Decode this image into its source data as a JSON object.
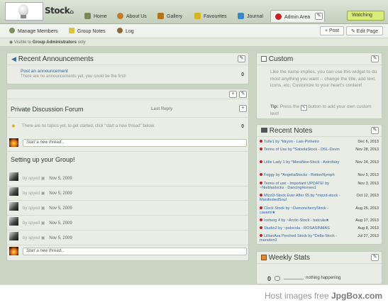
{
  "header": {
    "group_name": "Stock",
    "home_glyph": "⌂",
    "tabs": [
      {
        "label": "Home",
        "icon": "home-icon",
        "color": "#7a8a55"
      },
      {
        "label": "About Us",
        "icon": "people-icon",
        "color": "#c27a2c"
      },
      {
        "label": "Gallery",
        "icon": "gallery-icon",
        "color": "#b0741f"
      },
      {
        "label": "Favourites",
        "icon": "star-icon",
        "color": "#d6b41c"
      },
      {
        "label": "Journal",
        "icon": "journal-icon",
        "color": "#3b88c2"
      },
      {
        "label": "Admin Area",
        "icon": "no-entry-icon",
        "color": "#c82020"
      }
    ],
    "tab_edit_glyph": "✎",
    "watching_label": "Watching"
  },
  "subnav": {
    "items": [
      {
        "label": "Manage Members",
        "icon": "members-icon"
      },
      {
        "label": "Group Notes",
        "icon": "notes-icon"
      },
      {
        "label": "Log",
        "icon": "log-icon"
      }
    ],
    "post_label": "+ Post",
    "edit_page_label": "✎ Edit Page"
  },
  "visibility": {
    "prefix": "Visible to",
    "group": "Group Administrators",
    "suffix": "only"
  },
  "announcements": {
    "title": "Recent Announcements",
    "post_link": "Post an announcement",
    "empty_text": "There are no announcements yet, you could be the first!",
    "count": "0"
  },
  "forum": {
    "title": "Private Discussion Forum",
    "last_reply_header": "Last Reply",
    "plus_glyph": "+",
    "empty_text": "There are no topics yet, to get started, click \"start a new thread\" below.",
    "count": "0",
    "new_thread_placeholder": "Start a new thread..."
  },
  "setup": {
    "title": "Setting up your Group!",
    "posts": [
      {
        "by": "by",
        "user": "spyed",
        "date": "Nov 5, 2009"
      },
      {
        "by": "by",
        "user": "spyed",
        "date": "Nov 5, 2009"
      },
      {
        "by": "by",
        "user": "spyed",
        "date": "Nov 5, 2009"
      },
      {
        "by": "by",
        "user": "spyed",
        "date": "Nov 5, 2009"
      },
      {
        "by": "by",
        "user": "spyed",
        "date": "Nov 5, 2009"
      }
    ],
    "new_thread_placeholder": "Start a new thread..."
  },
  "custom": {
    "title": "Custom",
    "body": "Like the name implies, you can use this widget to do most anything you want -- change the title, add text, icons, etc. Customize to your heart's content!",
    "tip_label": "Tip:",
    "tip_before": "Press the",
    "tip_after": "button to add your own custom text!"
  },
  "notes": {
    "title": "Recent Notes",
    "items": [
      {
        "text": "Tulle1 by *ktryon - Lais-Pinheiro",
        "date": "Dec 6, 2013"
      },
      {
        "text": "Terms of Use by *SalsolaStock - DSL-Devin",
        "date": "Nov 28, 2013"
      },
      {
        "text": "Little Lady 1 by *MoraNox-Stock - Astrofairy",
        "date": "Nov 24, 2013"
      },
      {
        "text": "Foggy by *AngeliaStocks - RottonNymph",
        "date": "Nov 5, 2013"
      },
      {
        "text": "Terms of use - Important UPDATE! by ~Nieblastocks - DancingHorses1",
        "date": "Nov 3, 2013"
      },
      {
        "text": "MizzD-Stock Ever After 65 by *mizzd-stock - ManifestedSoul",
        "date": "Oct 12, 2013"
      },
      {
        "text": "Clock Stock by ~DemoncherryStock - cavami★",
        "date": "Aug 25, 2013"
      },
      {
        "text": "Iceberg 4 by ~Arctic-Stock - batcula★",
        "date": "Aug 17, 2013"
      },
      {
        "text": "Studio2 by ~polocola - ROSASINMAS",
        "date": "Aug 8, 2013"
      },
      {
        "text": "LillianAva Perched Stock by *Della-Stock - marsden3",
        "date": "Jul 27, 2013"
      }
    ]
  },
  "stats": {
    "title": "Weekly Stats",
    "value": "0",
    "status": "nothing happening"
  },
  "footer": {
    "prefix": "Host images free",
    "brand": "JpgBox.com"
  },
  "colors": {
    "accent_link": "#2d63a6",
    "watch_bg": "#d9ec7a",
    "note_dot": "#c31f1f"
  }
}
